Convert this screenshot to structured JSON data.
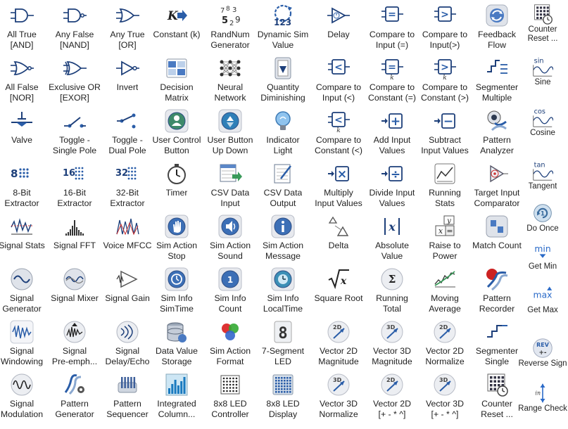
{
  "columns": [
    {
      "id": "c1",
      "items": [
        {
          "label": "All True\n[AND]",
          "icon": "and-gate-icon"
        },
        {
          "label": "All False\n[NOR]",
          "icon": "nor-gate-icon"
        },
        {
          "label": "Valve",
          "icon": "valve-icon"
        },
        {
          "label": "8-Bit\nExtractor",
          "icon": "bits-8-icon"
        },
        {
          "label": "Signal Stats",
          "icon": "signal-stats-icon"
        },
        {
          "label": "Signal\nGenerator",
          "icon": "signal-generator-icon"
        },
        {
          "label": "Signal\nWindowing",
          "icon": "signal-windowing-icon"
        },
        {
          "label": "Signal\nModulation",
          "icon": "signal-modulation-icon"
        }
      ]
    },
    {
      "id": "c2",
      "items": [
        {
          "label": "Any False\n[NAND]",
          "icon": "nand-gate-icon"
        },
        {
          "label": "Exclusive OR\n[EXOR]",
          "icon": "xor-gate-icon"
        },
        {
          "label": "Toggle -\nSingle Pole",
          "icon": "toggle-single-pole-icon"
        },
        {
          "label": "16-Bit\nExtractor",
          "icon": "bits-16-icon"
        },
        {
          "label": "Signal FFT",
          "icon": "signal-fft-icon"
        },
        {
          "label": "Signal Mixer",
          "icon": "signal-mixer-icon"
        },
        {
          "label": "Signal\nPre-emph...",
          "icon": "signal-preemphasis-icon"
        },
        {
          "label": "Pattern\nGenerator",
          "icon": "pattern-generator-icon"
        }
      ]
    },
    {
      "id": "c3",
      "items": [
        {
          "label": "Any True\n[OR]",
          "icon": "or-gate-icon"
        },
        {
          "label": "Invert",
          "icon": "not-gate-icon"
        },
        {
          "label": "Toggle -\nDual Pole",
          "icon": "toggle-dual-pole-icon"
        },
        {
          "label": "32-Bit\nExtractor",
          "icon": "bits-32-icon"
        },
        {
          "label": "Voice MFCC",
          "icon": "voice-mfcc-icon"
        },
        {
          "label": "Signal Gain",
          "icon": "signal-gain-icon"
        },
        {
          "label": "Signal\nDelay/Echo",
          "icon": "signal-delay-echo-icon"
        },
        {
          "label": "Pattern\nSequencer",
          "icon": "pattern-sequencer-icon"
        }
      ]
    },
    {
      "id": "c4",
      "items": [
        {
          "label": "Constant (k)",
          "icon": "constant-k-icon"
        },
        {
          "label": "Decision\nMatrix",
          "icon": "decision-matrix-icon"
        },
        {
          "label": "User Control\nButton",
          "icon": "user-control-button-icon"
        },
        {
          "label": "Timer",
          "icon": "timer-icon"
        },
        {
          "label": "Sim Action\nStop",
          "icon": "hand-stop-icon"
        },
        {
          "label": "Sim Info\nSimTime",
          "icon": "history-clock-icon"
        },
        {
          "label": "Data Value\nStorage",
          "icon": "database-icon"
        },
        {
          "label": "Integrated\nColumn...",
          "icon": "column-bars-icon"
        }
      ]
    },
    {
      "id": "c5",
      "items": [
        {
          "label": "RandNum\nGenerator",
          "icon": "random-number-icon"
        },
        {
          "label": "Neural\nNetwork",
          "icon": "neural-network-icon"
        },
        {
          "label": "User Button\nUp Down",
          "icon": "user-button-updown-icon"
        },
        {
          "label": "CSV Data\nInput",
          "icon": "csv-input-icon"
        },
        {
          "label": "Sim Action\nSound",
          "icon": "speaker-icon"
        },
        {
          "label": "Sim Info\nCount",
          "icon": "count-icon"
        },
        {
          "label": "Sim Action\nFormat",
          "icon": "color-format-icon"
        },
        {
          "label": "8x8 LED\nController",
          "icon": "led-controller-icon"
        }
      ]
    },
    {
      "id": "c6",
      "items": [
        {
          "label": "Dynamic Sim\nValue",
          "icon": "dynamic-sim-value-icon"
        },
        {
          "label": "Quantity\nDiminishing",
          "icon": "quantity-diminishing-icon"
        },
        {
          "label": "Indicator\nLight",
          "icon": "light-bulb-icon"
        },
        {
          "label": "CSV Data\nOutput",
          "icon": "csv-output-icon"
        },
        {
          "label": "Sim Action\nMessage",
          "icon": "info-message-icon"
        },
        {
          "label": "Sim Info\nLocalTime",
          "icon": "local-time-icon"
        },
        {
          "label": "7-Segment\nLED",
          "icon": "seven-segment-icon"
        },
        {
          "label": "8x8 LED\nDisplay",
          "icon": "led-display-icon"
        }
      ]
    },
    {
      "id": "c7",
      "items": [
        {
          "label": "Delay",
          "icon": "delay-icon"
        },
        {
          "label": "Compare to\nInput (<)",
          "icon": "compare-input-lt-icon"
        },
        {
          "label": "Compare to\nConstant (<)",
          "icon": "compare-constant-lt-icon"
        },
        {
          "label": "Multiply\nInput Values",
          "icon": "multiply-icon"
        },
        {
          "label": "Delta",
          "icon": "delta-icon"
        },
        {
          "label": "Square Root",
          "icon": "square-root-icon"
        },
        {
          "label": "Vector 2D\nMagnitude",
          "icon": "vector-2d-magnitude-icon"
        },
        {
          "label": "Vector 3D\nNormalize",
          "icon": "vector-3d-normalize-icon"
        }
      ]
    },
    {
      "id": "c8",
      "items": [
        {
          "label": "Compare to\nInput (=)",
          "icon": "compare-input-eq-icon"
        },
        {
          "label": "Compare to\nConstant (=)",
          "icon": "compare-constant-eq-icon"
        },
        {
          "label": "Add Input\nValues",
          "icon": "add-icon"
        },
        {
          "label": "Divide Input\nValues",
          "icon": "divide-icon"
        },
        {
          "label": "Absolute\nValue",
          "icon": "absolute-value-icon"
        },
        {
          "label": "Running\nTotal",
          "icon": "running-total-icon"
        },
        {
          "label": "Vector 3D\nMagnitude",
          "icon": "vector-3d-magnitude-icon"
        },
        {
          "label": "Vector 2D\n[+ - * ^]",
          "icon": "vector-2d-ops-icon"
        }
      ]
    },
    {
      "id": "c9",
      "items": [
        {
          "label": "Compare to\nInput(>)",
          "icon": "compare-input-gt-icon"
        },
        {
          "label": "Compare to\nConstant (>)",
          "icon": "compare-constant-gt-icon"
        },
        {
          "label": "Subtract\nInput Values",
          "icon": "subtract-icon"
        },
        {
          "label": "Running\nStats",
          "icon": "running-stats-icon"
        },
        {
          "label": "Raise to\nPower",
          "icon": "power-icon"
        },
        {
          "label": "Moving\nAverage",
          "icon": "moving-average-icon"
        },
        {
          "label": "Vector 2D\nNormalize",
          "icon": "vector-2d-normalize-icon"
        },
        {
          "label": "Vector 3D\n[+ - * ^]",
          "icon": "vector-3d-ops-icon"
        }
      ]
    },
    {
      "id": "c10",
      "items": [
        {
          "label": "Feedback\nFlow",
          "icon": "feedback-flow-icon"
        },
        {
          "label": "Segmenter\nMultiple",
          "icon": "segmenter-multiple-icon"
        },
        {
          "label": "Pattern\nAnalyzer",
          "icon": "pattern-analyzer-icon"
        },
        {
          "label": "Target Input\nComparator",
          "icon": "target-comparator-icon"
        },
        {
          "label": "Match Count",
          "icon": "match-count-icon"
        },
        {
          "label": "Pattern\nRecorder",
          "icon": "pattern-recorder-icon"
        },
        {
          "label": "Segmenter\nSingle",
          "icon": "segmenter-single-icon"
        },
        {
          "label": "Counter\nReset ...",
          "icon": "counter-reset-icon"
        }
      ]
    },
    {
      "id": "c11",
      "items": [
        {
          "label": "Counter\nReset ...",
          "icon": "counter-reset-icon"
        },
        {
          "label": "Sine",
          "icon": "sine-icon"
        },
        {
          "label": "Cosine",
          "icon": "cosine-icon"
        },
        {
          "label": "Tangent",
          "icon": "tangent-icon"
        },
        {
          "label": "Do Once",
          "icon": "do-once-icon"
        },
        {
          "label": "Get Min",
          "icon": "min-icon"
        },
        {
          "label": "Get Max",
          "icon": "max-icon"
        },
        {
          "label": "Reverse Sign",
          "icon": "reverse-sign-icon"
        },
        {
          "label": "Range Check",
          "icon": "range-check-icon"
        }
      ]
    }
  ]
}
